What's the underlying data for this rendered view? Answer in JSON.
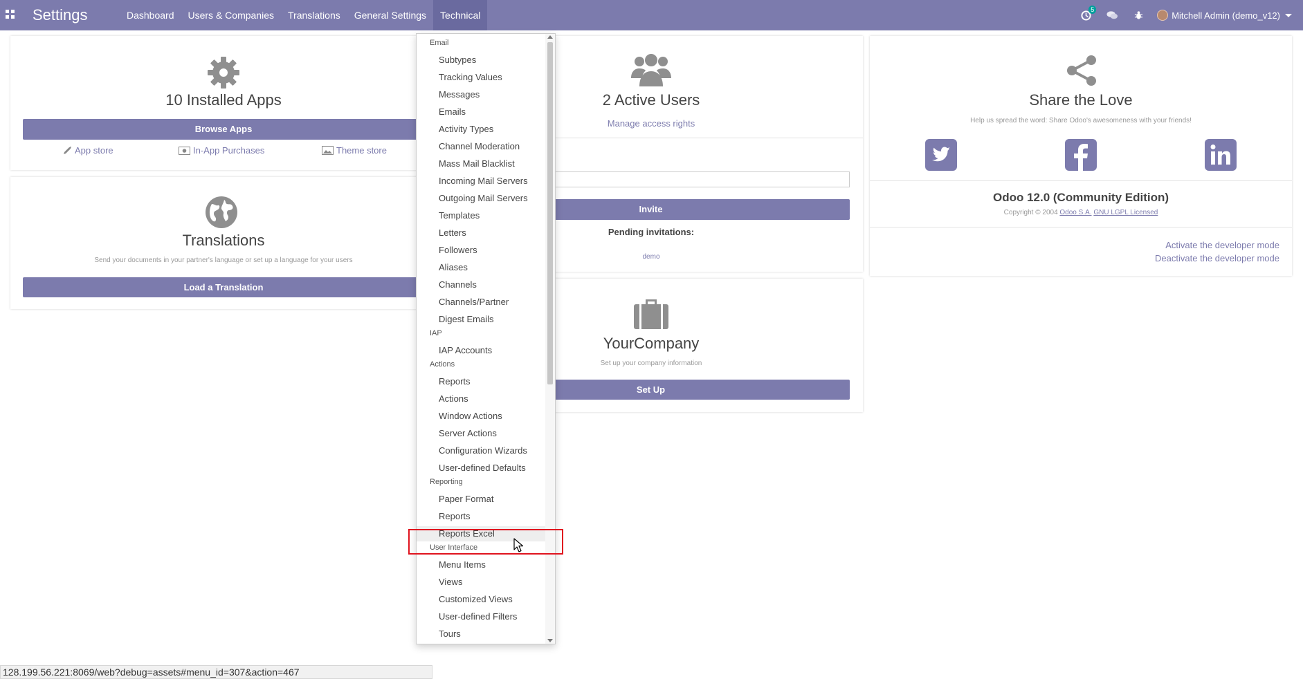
{
  "navbar": {
    "app_title": "Settings",
    "menu": [
      "Dashboard",
      "Users & Companies",
      "Translations",
      "General Settings",
      "Technical"
    ],
    "active_menu": "Technical",
    "activity_badge": "5",
    "user": "Mitchell Admin (demo_v12)"
  },
  "apps_card": {
    "title": "10 Installed Apps",
    "button": "Browse Apps",
    "links": [
      "App store",
      "In-App Purchases",
      "Theme store"
    ]
  },
  "translations_card": {
    "title": "Translations",
    "subtitle": "Send your documents in your partner's language or set up a language for your users",
    "button": "Load a Translation"
  },
  "users_card": {
    "title": "2 Active Users",
    "link": "Manage access rights",
    "invite_button": "Invite",
    "pending_label": "Pending invitations:",
    "pending_user": "demo"
  },
  "company_card": {
    "title": "YourCompany",
    "subtitle": "Set up your company information",
    "button": "Set Up"
  },
  "share_card": {
    "title": "Share the Love",
    "subtitle": "Help us spread the word: Share Odoo's awesomeness with your friends!",
    "version": "Odoo 12.0 (Community Edition)",
    "copyright_prefix": "Copyright © 2004",
    "company_link": "Odoo S.A.",
    "license_link": "GNU LGPL Licensed",
    "dev_activate": "Activate the developer mode",
    "dev_deactivate": "Deactivate the developer mode"
  },
  "dropdown": {
    "sections": [
      {
        "header": "Email",
        "items": [
          "Subtypes",
          "Tracking Values",
          "Messages",
          "Emails",
          "Activity Types",
          "Channel Moderation",
          "Mass Mail Blacklist",
          "Incoming Mail Servers",
          "Outgoing Mail Servers",
          "Templates",
          "Letters",
          "Followers",
          "Aliases",
          "Channels",
          "Channels/Partner",
          "Digest Emails"
        ]
      },
      {
        "header": "IAP",
        "items": [
          "IAP Accounts"
        ]
      },
      {
        "header": "Actions",
        "items": [
          "Reports",
          "Actions",
          "Window Actions",
          "Server Actions",
          "Configuration Wizards",
          "User-defined Defaults"
        ]
      },
      {
        "header": "Reporting",
        "items": [
          "Paper Format",
          "Reports",
          "Reports Excel"
        ]
      },
      {
        "header": "User Interface",
        "items": [
          "Menu Items",
          "Views",
          "Customized Views",
          "User-defined Filters",
          "Tours"
        ]
      }
    ],
    "highlighted_item": "Reports Excel"
  },
  "status_url": "128.199.56.221:8069/web?debug=assets#menu_id=307&action=467",
  "colors": {
    "brand": "#7c7bad",
    "highlight_border": "#e0131e",
    "badge": "#00a09d"
  }
}
